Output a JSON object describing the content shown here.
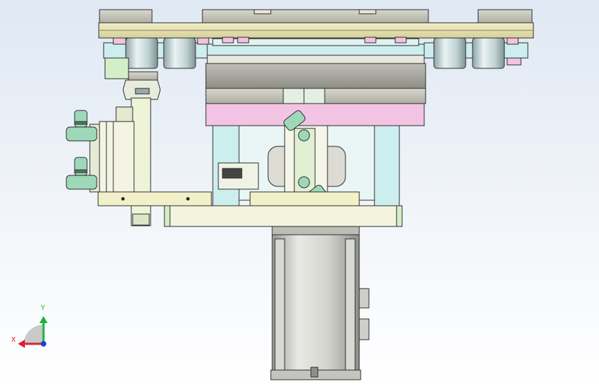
{
  "viewport": {
    "background_top": "#dfe8f3",
    "background_bottom": "#ffffff"
  },
  "triad": {
    "x_label": "X",
    "y_label": "Y",
    "x_color": "#d8222b",
    "y_color": "#19b23b",
    "z_color": "#1f3fd6"
  },
  "colors": {
    "plate_tan": "#e4dfa7",
    "plate_grey": "#c9c8bc",
    "bracket_cyan": "#cdeeee",
    "accent_pink": "#f2c3e3",
    "fitting_green": "#9fd8b8",
    "motor_grey": "#d5d5d0"
  }
}
